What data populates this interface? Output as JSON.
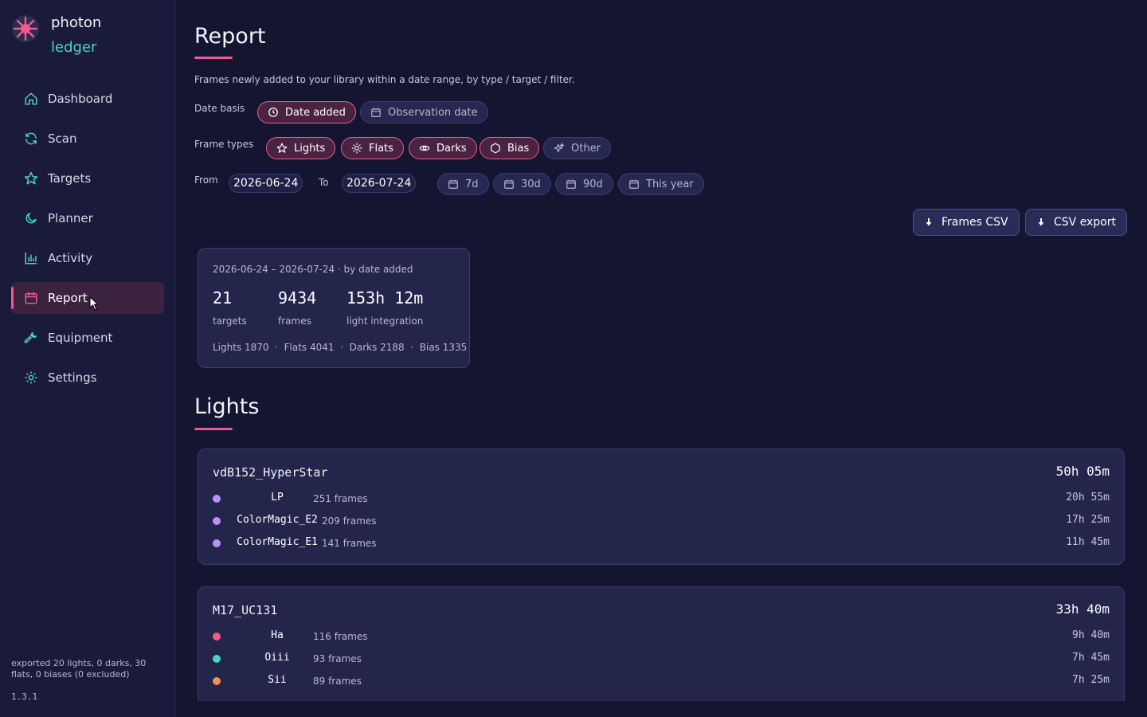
{
  "brand": {
    "line1": "photon",
    "line2": "ledger"
  },
  "nav": [
    {
      "label": "Dashboard",
      "icon": "home-icon"
    },
    {
      "label": "Scan",
      "icon": "refresh-icon"
    },
    {
      "label": "Targets",
      "icon": "star-icon"
    },
    {
      "label": "Planner",
      "icon": "moon-icon"
    },
    {
      "label": "Activity",
      "icon": "bar-chart-icon"
    },
    {
      "label": "Report",
      "icon": "calendar-icon",
      "active": true
    },
    {
      "label": "Equipment",
      "icon": "wrench-icon"
    },
    {
      "label": "Settings",
      "icon": "gear-icon"
    }
  ],
  "footer": {
    "status": "exported 20 lights, 0 darks, 30 flats, 0 biases (0 excluded)",
    "version": "1.3.1"
  },
  "page": {
    "title": "Report",
    "description": "Frames newly added to your library within a date range, by type / target / filter.",
    "date_basis": {
      "label": "Date basis",
      "options": [
        "Date added",
        "Observation date"
      ],
      "selected": "Date added"
    },
    "frame_types": {
      "label": "Frame types",
      "options": [
        "Lights",
        "Flats",
        "Darks",
        "Bias",
        "Other"
      ],
      "selected": [
        "Lights",
        "Flats",
        "Darks",
        "Bias"
      ]
    },
    "range": {
      "from_label": "From",
      "from": "2026-06-24",
      "to_label": "To",
      "to": "2026-07-24",
      "presets": [
        "7d",
        "30d",
        "90d",
        "This year"
      ]
    },
    "buttons": {
      "frames_csv": "Frames CSV",
      "csv_export": "CSV export"
    }
  },
  "summary": {
    "range_text": "2026-06-24 – 2026-07-24 · by date added",
    "targets": {
      "value": "21",
      "label": "targets"
    },
    "frames": {
      "value": "9434",
      "label": "frames"
    },
    "integration": {
      "value": "153h 12m",
      "label": "light integration"
    },
    "breakdown": "Lights 1870  ·  Flats 4041  ·  Darks 2188  ·  Bias 1335"
  },
  "lights_section": {
    "title": "Lights"
  },
  "lights": [
    {
      "target": "vdB152_HyperStar",
      "total": "50h 05m",
      "filters": [
        {
          "name": "LP",
          "frames": "251 frames",
          "duration": "20h 55m",
          "color": "#b794f6"
        },
        {
          "name": "ColorMagic_E2",
          "frames": "209 frames",
          "duration": "17h 25m",
          "color": "#b794f6"
        },
        {
          "name": "ColorMagic_E1",
          "frames": "141 frames",
          "duration": "11h 45m",
          "color": "#b794f6"
        }
      ]
    },
    {
      "target": "M17_UC131",
      "total": "33h 40m",
      "filters": [
        {
          "name": "Ha",
          "frames": "116 frames",
          "duration": "9h 40m",
          "color": "#f2598d"
        },
        {
          "name": "Oiii",
          "frames": "93 frames",
          "duration": "7h 45m",
          "color": "#4fd1c5"
        },
        {
          "name": "Sii",
          "frames": "89 frames",
          "duration": "7h 25m",
          "color": "#f6924a"
        }
      ]
    }
  ]
}
